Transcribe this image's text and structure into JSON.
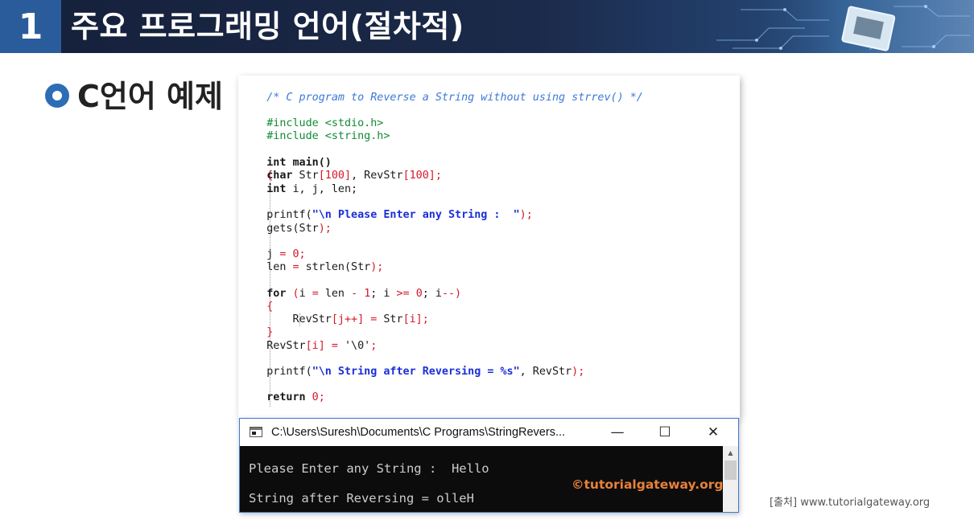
{
  "header": {
    "section_number": "1",
    "title": "주요 프로그래밍 언어(절차적)"
  },
  "heading": {
    "text": "C언어 예제"
  },
  "code": {
    "comment": "/* C program to Reverse a String without using strrev() */",
    "include_stdio": "#include <stdio.h>",
    "include_string": "#include <string.h>",
    "main_decl": "int main()",
    "open_brace": "{",
    "close_brace": "}",
    "decl_char": {
      "kw": "char",
      "a": " Str",
      "b": "[100]",
      "c": ", RevStr",
      "d": "[100];"
    },
    "decl_int": {
      "kw": "int",
      "rest": " i, j, len;"
    },
    "printf1": {
      "fn": "printf(",
      "str": "\"\\n Please Enter any String :  \"",
      "end": ");"
    },
    "gets": {
      "fn": "gets(Str",
      "end": ");"
    },
    "assign_j": {
      "a": "j ",
      "b": "= ",
      "c": "0;"
    },
    "assign_len": {
      "a": "len ",
      "b": "= ",
      "c": "strlen(Str",
      "d": ");"
    },
    "for_line": {
      "kw": "for",
      "a": " (",
      "b": "i ",
      "c": "= ",
      "d": "len ",
      "e": "- ",
      "f": "1",
      "g": "; i ",
      "h": ">= ",
      "i": "0",
      "j": "; i",
      "k": "--)"
    },
    "loop_open": "{",
    "loop_body": {
      "a": "RevStr",
      "b": "[j++] = ",
      "c": "Str",
      "d": "[i];"
    },
    "loop_close": "}",
    "null_term": {
      "a": "RevStr",
      "b": "[i] = ",
      "c": "'\\0'",
      "d": ";"
    },
    "printf2": {
      "fn": "printf(",
      "str": "\"\\n String after Reversing = %s\"",
      "mid": ", RevStr",
      "end": ");"
    },
    "return_line": {
      "kw": "return",
      "val": " 0;"
    }
  },
  "console": {
    "title": "C:\\Users\\Suresh\\Documents\\C Programs\\StringRevers...",
    "minimize": "—",
    "maximize": "☐",
    "close": "✕",
    "output_line1": "Please Enter any String :  Hello",
    "output_line2": "String after Reversing = olleH",
    "watermark": "©tutorialgateway.org"
  },
  "source_note": "[출처] www.tutorialgateway.org",
  "colors": {
    "header_bg": "#1b2a4a",
    "number_box": "#2a5c9c",
    "bullet": "#2c6db5",
    "comment": "#3b78d8",
    "preprocessor": "#138a36",
    "string": "#1a2fd6",
    "number": "#d4182a",
    "console_bg": "#0c0c0c",
    "watermark": "#e8813a"
  },
  "icons": {
    "bullet": "ring-bullet-icon",
    "console_app": "console-window-icon",
    "header_art": "circuit-chip-graphic"
  }
}
